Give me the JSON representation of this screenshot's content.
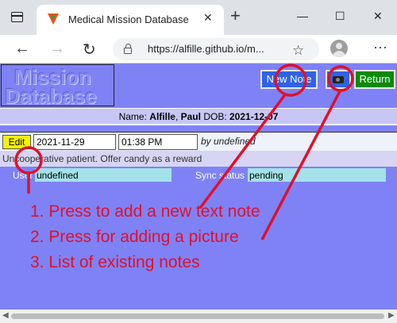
{
  "browser": {
    "tab_title": "Medical Mission Database",
    "tab_close": "✕",
    "new_tab": "+",
    "minimize": "—",
    "maximize": "☐",
    "close": "✕",
    "back": "←",
    "forward": "→",
    "refresh": "↻",
    "url": "https://alfille.github.io/m...",
    "star_icon": "☆",
    "menu": "⋯"
  },
  "app": {
    "logo_line1": "Mission",
    "logo_line2": "Database",
    "new_note_button": "New Note",
    "return_button": "Return",
    "patient": {
      "name_label": "Name:",
      "last_name": "Alfille",
      "first_name": "Paul",
      "dob_label": "DOB:",
      "dob": "2021-12-07"
    },
    "note": {
      "edit_button": "Edit",
      "date": "2021-11-29",
      "time": "01:38 PM",
      "byline": "by undefined",
      "text": "Uncooperative patient. Offer candy as a reward"
    },
    "status": {
      "user_label": "User",
      "user_value": "undefined",
      "sync_label": "Sync status",
      "sync_value": "pending"
    }
  },
  "annotations": {
    "line1": "1. Press to add a new text note",
    "line2": "2. Press for adding a picture",
    "line3": "3. List of existing notes",
    "color": "#e0102c"
  },
  "colors": {
    "page_background": "#7f82f5",
    "new_note_button": "#2f63e6",
    "return_button": "#0a8a0a",
    "edit_button": "#f5f200",
    "status_value": "#a3e2e9"
  }
}
